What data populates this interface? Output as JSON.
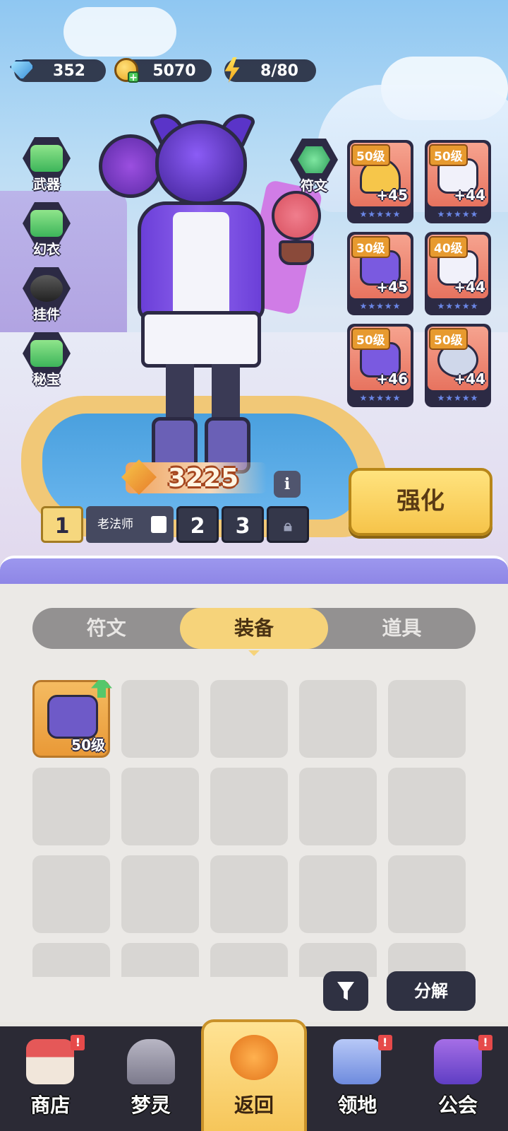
{
  "currencies": {
    "gems": "352",
    "coins": "5070",
    "energy": "8/80"
  },
  "left_categories": [
    {
      "label": "武器",
      "icon": "weapon-icon"
    },
    {
      "label": "幻衣",
      "icon": "costume-icon"
    },
    {
      "label": "挂件",
      "icon": "pendant-icon"
    },
    {
      "label": "秘宝",
      "icon": "treasure-icon"
    }
  ],
  "rune_button": {
    "label": "符文",
    "icon": "rune-icon"
  },
  "equipment_slots": [
    {
      "level": "50级",
      "bonus": "+45",
      "icon": "helmet-icon"
    },
    {
      "level": "50级",
      "bonus": "+44",
      "icon": "jacket-icon"
    },
    {
      "level": "30级",
      "bonus": "+45",
      "icon": "bracer-icon"
    },
    {
      "level": "40级",
      "bonus": "+44",
      "icon": "shorts-icon"
    },
    {
      "level": "50级",
      "bonus": "+46",
      "icon": "shoes-icon"
    },
    {
      "level": "50级",
      "bonus": "+44",
      "icon": "eye-orb-icon"
    }
  ],
  "power": "3225",
  "presets": {
    "active": "1",
    "name": "老法师",
    "others": [
      "2",
      "3"
    ]
  },
  "enhance_label": "强化",
  "tabs": [
    {
      "label": "符文",
      "active": false
    },
    {
      "label": "装备",
      "active": true
    },
    {
      "label": "道具",
      "active": false
    }
  ],
  "inventory": {
    "items": [
      {
        "level": "50级",
        "icon": "bracer-icon",
        "upgradable": true
      }
    ]
  },
  "decompose_label": "分解",
  "nav": [
    {
      "label": "商店",
      "icon": "shop-icon",
      "alert": "!",
      "active": false
    },
    {
      "label": "梦灵",
      "icon": "dream-spirit-icon",
      "alert": "",
      "active": false
    },
    {
      "label": "返回",
      "icon": "back-icon",
      "alert": "",
      "active": true
    },
    {
      "label": "领地",
      "icon": "territory-icon",
      "alert": "!",
      "active": false
    },
    {
      "label": "公会",
      "icon": "guild-icon",
      "alert": "!",
      "active": false
    }
  ]
}
